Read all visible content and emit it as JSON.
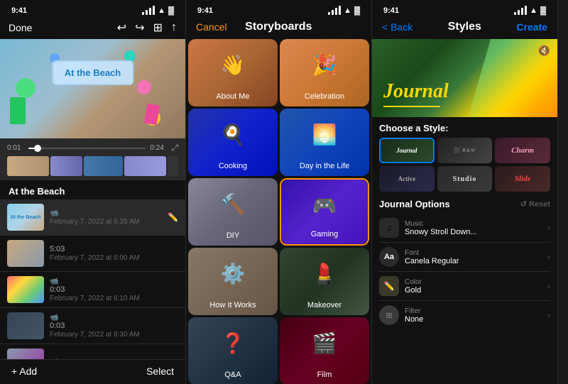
{
  "phones": {
    "phone1": {
      "status_time": "9:41",
      "header": {
        "done": "Done",
        "icons": [
          "↩",
          "↪",
          "⊞",
          "↑"
        ]
      },
      "video": {
        "beach_card_text": "At the Beach"
      },
      "timeline": {
        "start_time": "0:01",
        "end_time": "0:24"
      },
      "project_title": "At the Beach",
      "clips": [
        {
          "id": 1,
          "type": "video",
          "duration": "",
          "date": "February 7, 2022 at 6:35 AM",
          "active": true
        },
        {
          "id": 2,
          "type": "video",
          "duration": "5:03",
          "date": "February 7, 2022 at 6:00 AM",
          "active": false
        },
        {
          "id": 3,
          "type": "video",
          "duration": "0:03",
          "date": "February 7, 2022 at 6:10 AM",
          "active": false
        },
        {
          "id": 4,
          "type": "video",
          "duration": "0:03",
          "date": "February 7, 2022 at 6:30 AM",
          "active": false
        },
        {
          "id": 5,
          "type": "video",
          "duration": "",
          "date": "",
          "active": false
        }
      ],
      "footer": {
        "add": "+ Add",
        "select": "Select"
      }
    },
    "phone2": {
      "status_time": "9:41",
      "header": {
        "cancel": "Cancel",
        "title": "Storyboards"
      },
      "items": [
        {
          "id": "about-me",
          "label": "About Me",
          "icon": "👋"
        },
        {
          "id": "celebration",
          "label": "Celebration",
          "icon": "🎉"
        },
        {
          "id": "cooking",
          "label": "Cooking",
          "icon": "🍳"
        },
        {
          "id": "day-in-life",
          "label": "Day in the Life",
          "icon": "🌅"
        },
        {
          "id": "diy",
          "label": "DIY",
          "icon": "🔨"
        },
        {
          "id": "gaming",
          "label": "Gaming",
          "icon": "🎮",
          "selected": true
        },
        {
          "id": "how-it-works",
          "label": "How It Works",
          "icon": "⚙️"
        },
        {
          "id": "makeover",
          "label": "Makeover",
          "icon": "💄"
        },
        {
          "id": "qa",
          "label": "Q&A",
          "icon": "❓"
        },
        {
          "id": "film",
          "label": "Film",
          "icon": "🎬"
        }
      ]
    },
    "phone3": {
      "status_time": "9:41",
      "header": {
        "back": "< Back",
        "title": "Styles",
        "create": "Create"
      },
      "preview": {
        "title": "Journal"
      },
      "choose_style_label": "Choose a Style:",
      "styles": [
        {
          "id": "journal",
          "label": "Journal",
          "selected": true
        },
        {
          "id": "bw",
          "label": ""
        },
        {
          "id": "charm",
          "label": "Charm"
        },
        {
          "id": "active",
          "label": "Active"
        },
        {
          "id": "studio",
          "label": "Studio"
        },
        {
          "id": "slide",
          "label": "Slide"
        }
      ],
      "journal_options_title": "Journal Options",
      "reset": "↺ Reset",
      "options": [
        {
          "icon": "♫",
          "title": "Music",
          "value": "Snowy Stroll Down..."
        },
        {
          "icon": "Aa",
          "title": "Font",
          "value": "Canela Regular"
        },
        {
          "icon": "🎨",
          "title": "Color",
          "value": "Gold"
        },
        {
          "icon": "⊞",
          "title": "Filter",
          "value": "None"
        }
      ]
    }
  }
}
